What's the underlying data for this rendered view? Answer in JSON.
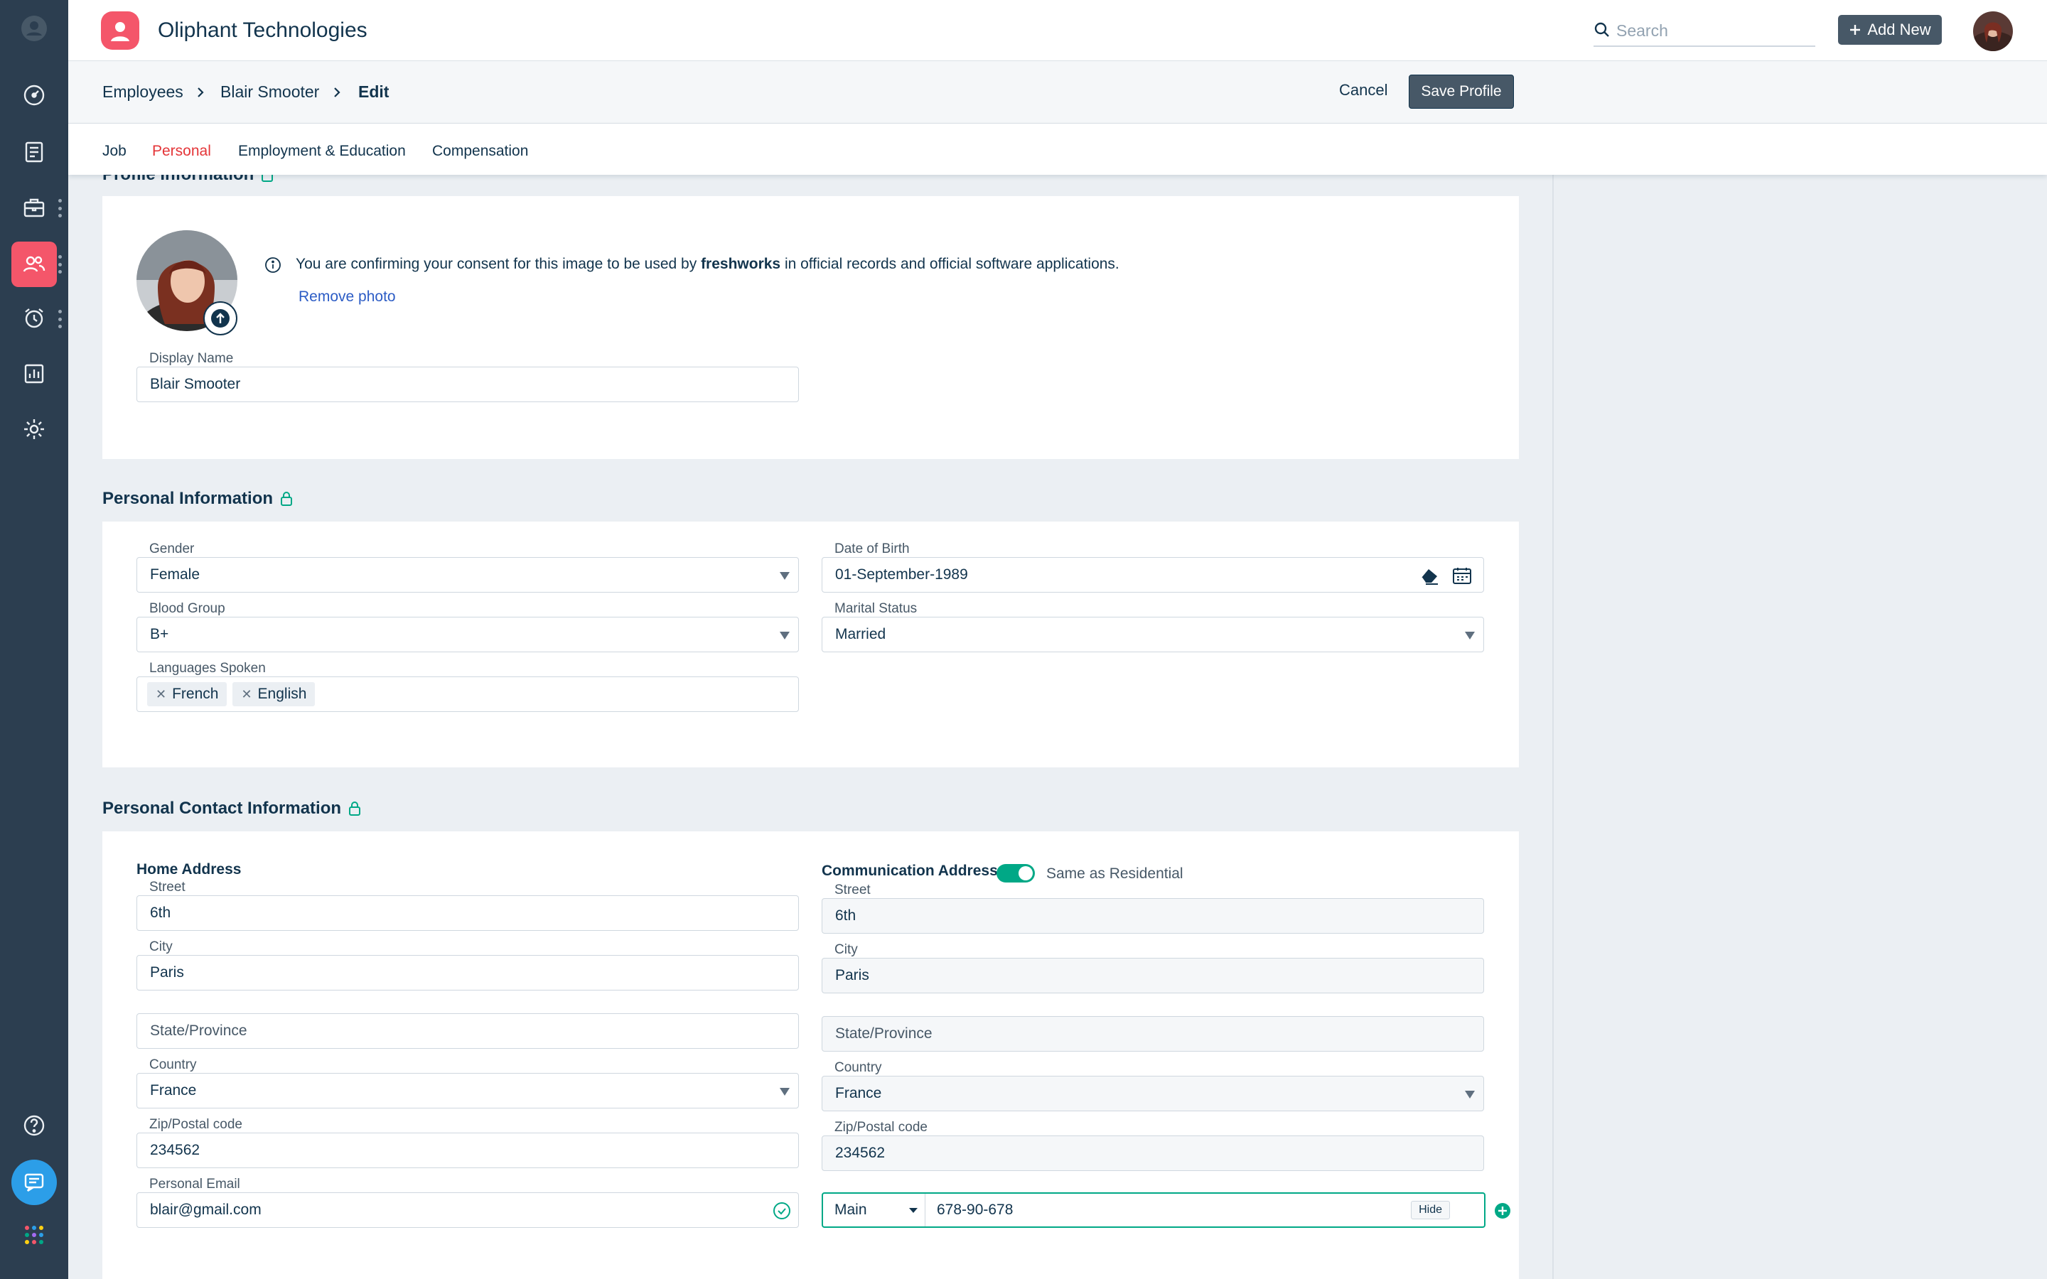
{
  "header": {
    "company": "Oliphant Technologies",
    "search_placeholder": "Search",
    "add_new_label": "Add New"
  },
  "breadcrumb": {
    "items": [
      "Employees",
      "Blair Smooter",
      "Edit"
    ],
    "cancel_label": "Cancel",
    "save_label": "Save Profile"
  },
  "tabs": [
    {
      "label": "Job",
      "active": false
    },
    {
      "label": "Personal",
      "active": true
    },
    {
      "label": "Employment & Education",
      "active": false
    },
    {
      "label": "Compensation",
      "active": false
    }
  ],
  "profile": {
    "section_title": "Profile Information",
    "consent_before": "You are confirming your consent for this image to be used by",
    "consent_brand": "freshworks",
    "consent_after": "in official records and official software applications.",
    "remove_photo": "Remove photo",
    "display_name_label": "Display Name",
    "display_name_value": "Blair Smooter"
  },
  "personal": {
    "section_title": "Personal Information",
    "gender_label": "Gender",
    "gender_value": "Female",
    "dob_label": "Date of Birth",
    "dob_value": "01-September-1989",
    "blood_label": "Blood Group",
    "blood_value": "B+",
    "marital_label": "Marital Status",
    "marital_value": "Married",
    "languages_label": "Languages Spoken",
    "languages": [
      "French",
      "English"
    ]
  },
  "contact": {
    "section_title": "Personal Contact Information",
    "home": {
      "heading": "Home Address",
      "street_label": "Street",
      "street_value": "6th",
      "city_label": "City",
      "city_value": "Paris",
      "state_placeholder": "State/Province",
      "country_label": "Country",
      "country_value": "France",
      "zip_label": "Zip/Postal code",
      "zip_value": "234562"
    },
    "comm": {
      "heading": "Communication Address",
      "same_as_label": "Same as Residential",
      "same_as_on": true,
      "street_label": "Street",
      "street_value": "6th",
      "city_label": "City",
      "city_value": "Paris",
      "state_placeholder": "State/Province",
      "country_label": "Country",
      "country_value": "France",
      "zip_label": "Zip/Postal code",
      "zip_value": "234562"
    },
    "email_label": "Personal Email",
    "email_value": "blair@gmail.com",
    "phone_type": "Main",
    "phone_value": "678-90-678",
    "hide_label": "Hide"
  },
  "colors": {
    "sidebar": "#2c3e50",
    "accent": "#f4566a",
    "active_tab": "#e43538",
    "primary_button": "#475867",
    "link": "#2c5cc5",
    "success": "#00a886"
  }
}
